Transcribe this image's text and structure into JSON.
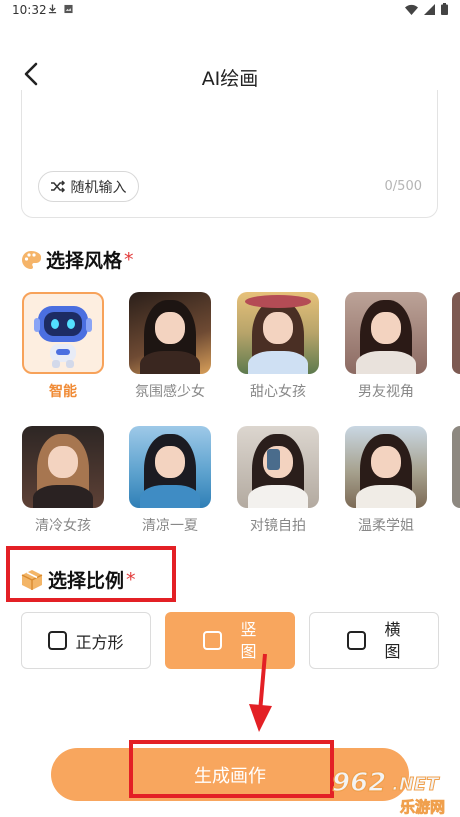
{
  "status_bar": {
    "time": "10:32"
  },
  "header": {
    "title": "AI绘画"
  },
  "prompt": {
    "random_label": "随机输入",
    "counter": "0/500"
  },
  "style_section": {
    "title": "选择风格",
    "required_mark": "*"
  },
  "styles": [
    {
      "label": "智能"
    },
    {
      "label": "氛围感少女"
    },
    {
      "label": "甜心女孩"
    },
    {
      "label": "男友视角"
    },
    {
      "label": "清冷女孩"
    },
    {
      "label": "清凉一夏"
    },
    {
      "label": "对镜自拍"
    },
    {
      "label": "温柔学姐"
    }
  ],
  "ratio_section": {
    "title": "选择比例",
    "required_mark": "*"
  },
  "ratios": {
    "square": "正方形",
    "portrait_1": "竖",
    "portrait_2": "图",
    "landscape_1": "横",
    "landscape_2": "图"
  },
  "generate": {
    "label": "生成画作"
  },
  "watermark": {
    "text1": "962",
    "text2": ".NET",
    "text3": "乐游网"
  },
  "colors": {
    "accent": "#f8a65e",
    "highlight": "#e32025",
    "required": "#e23b3b"
  }
}
